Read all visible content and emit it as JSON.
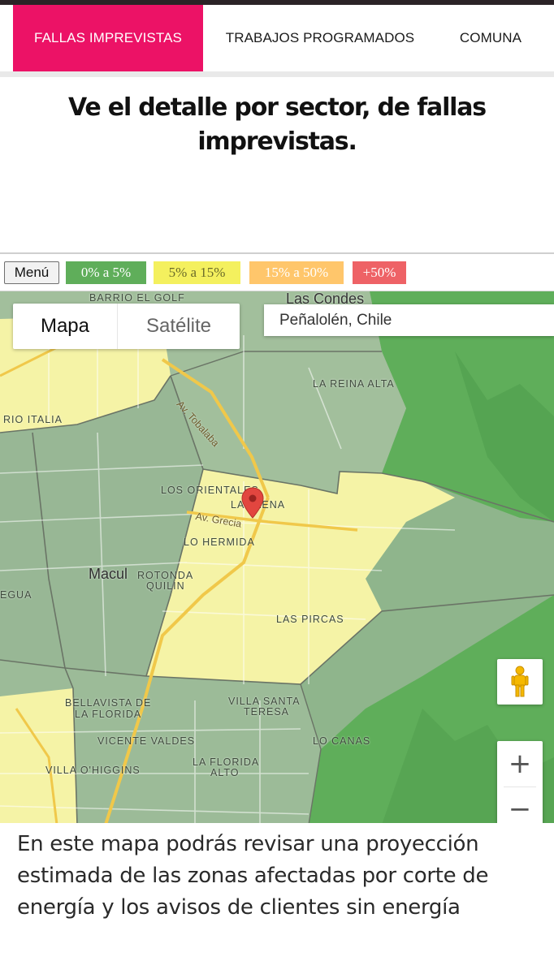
{
  "nav": {
    "tabs": [
      {
        "label": "FALLAS IMPREVISTAS",
        "active": true
      },
      {
        "label": "TRABAJOS PROGRAMADOS",
        "active": false
      },
      {
        "label": "COMUNA",
        "active": false
      }
    ]
  },
  "headline": "Ve el detalle por sector, de fallas imprevistas.",
  "map": {
    "menu_label": "Menú",
    "legend": [
      {
        "label": "0% a 5%",
        "color": "#5fae5a"
      },
      {
        "label": "5% a 15%",
        "color": "#f4f05e"
      },
      {
        "label": "15% a 50%",
        "color": "#ffc66b"
      },
      {
        "label": "+50%",
        "color": "#ee6266"
      }
    ],
    "map_type": {
      "options": [
        "Mapa",
        "Satélite"
      ],
      "selected": "Mapa"
    },
    "search": {
      "value": "Peñalolén, Chile"
    },
    "labels": {
      "barrio_el_golf": "BARRIO EL GOLF",
      "las_condes": "Las Condes",
      "la_reina_alta": "LA REINA ALTA",
      "rio_italia": "RIO ITALIA",
      "av_tobalaba": "Av. Tobalaba",
      "los_orientales": "LOS ORIENTALES",
      "la_faena": "LA FAENA",
      "av_grecia": "Av. Grecia",
      "lo_hermida": "LO HERMIDA",
      "macul": "Macul",
      "rotonda_quilin_1": "ROTONDA",
      "rotonda_quilin_2": "QUILIN",
      "egua": "EGUA",
      "las_pircas": "LAS PIRCAS",
      "bellavista_1": "BELLAVISTA DE",
      "bellavista_2": "LA FLORIDA",
      "villa_santa_teresa_1": "VILLA SANTA",
      "villa_santa_teresa_2": "TERESA",
      "vicente_valdes": "VICENTE VALDES",
      "lo_canas": "LO CANAS",
      "villa_ohiggins": "VILLA O'HIGGINS",
      "la_florida_alto_1": "LA FLORIDA",
      "la_florida_alto_2": "ALTO"
    },
    "zoom": {
      "in": "+",
      "out": "−"
    },
    "icons": {
      "pegman": "pegman-icon",
      "pin": "location-pin-icon"
    }
  },
  "description": "En este mapa podrás revisar una proyección estimada de las zonas afectadas por corte de energía y los avisos de clientes sin energía"
}
